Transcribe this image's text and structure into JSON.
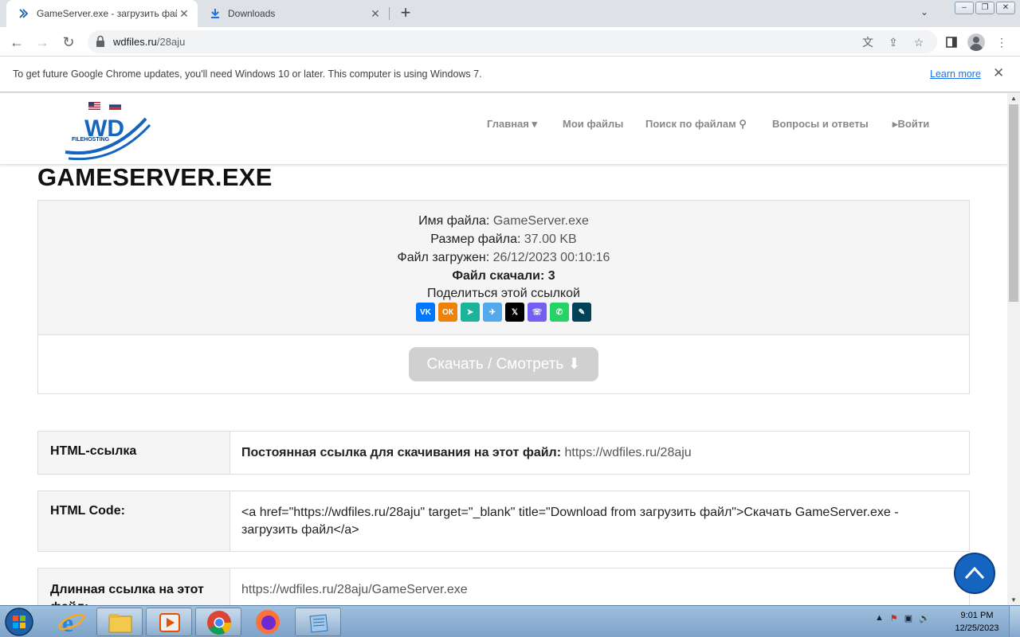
{
  "browser": {
    "tabs": [
      {
        "title": "GameServer.exe - загрузить фай",
        "icon": "wdfiles-favicon-icon"
      },
      {
        "title": "Downloads",
        "icon": "download-icon"
      }
    ],
    "url_host": "wdfiles.ru",
    "url_path": "/28aju",
    "info_message": "To get future Google Chrome updates, you'll need Windows 10 or later. This computer is using Windows 7.",
    "info_link": "Learn more"
  },
  "site": {
    "logo_text": "WD",
    "logo_subtext": "FILEHOSTING",
    "menu": [
      "Главная",
      "Мои файлы",
      "Поиск по файлам",
      "Войти"
    ],
    "page_title": "GAMESERVER.EXE",
    "file": {
      "name_label": "Имя файла:",
      "name_value": "GameServer.exe",
      "size_label": "Размер файла:",
      "size_value": "37.00 KB",
      "uploaded_label": "Файл загружен:",
      "uploaded_value": "26/12/2023 00:10:16",
      "downloads_label": "Файл скачали:",
      "downloads_value": "3",
      "share_label": "Поделиться этой ссылкой"
    },
    "share_icons": [
      "vk-icon",
      "odnoklassniki-icon",
      "sferum-icon",
      "telegram-icon",
      "x-icon",
      "viber-icon",
      "whatsapp-icon",
      "livejournal-icon"
    ],
    "share_colors": [
      "#0077ff",
      "#ee8208",
      "#1cb39b",
      "#54a9eb",
      "#000000",
      "#7360f2",
      "#25d366",
      "#004359"
    ],
    "download_button": "Скачать / Смотреть",
    "rows": [
      {
        "key": "HTML-ссылка",
        "label": "Постоянная ссылка для скачивания на этот файл:",
        "link": "https://wdfiles.ru/28aju"
      },
      {
        "key": "HTML Code:",
        "text": "<a href=\"https://wdfiles.ru/28aju\" target=\"_blank\" title=\"Download from загрузить файл\">Скачать GameServer.exe - загрузить файл</a>"
      },
      {
        "key": "Длинная ссылка на этот файл:",
        "link": "https://wdfiles.ru/28aju/GameServer.exe"
      }
    ]
  },
  "taskbar": {
    "time": "9:01 PM",
    "date": "12/25/2023",
    "apps": [
      "internet-explorer-icon",
      "file-explorer-icon",
      "media-player-icon",
      "chrome-icon",
      "firefox-icon",
      "notepad-icon"
    ]
  }
}
